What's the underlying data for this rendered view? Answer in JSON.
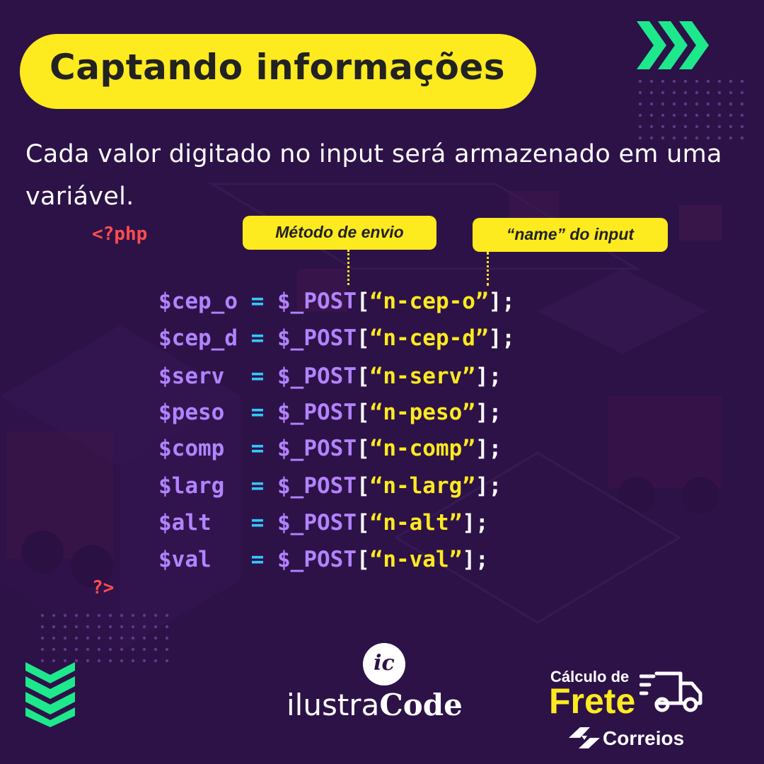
{
  "header": {
    "title": "Captando informações",
    "accent_color": "#fdea1f",
    "decor_icon": "triple-chevron-right-icon",
    "decor_color": "#1ee88c"
  },
  "description": "Cada valor digitado no input será armazenado em uma variável.",
  "callouts": {
    "method": "Método de envio",
    "name": "“name” do input"
  },
  "code": {
    "open_tag": "<?php",
    "close_tag": "?>",
    "lines": [
      {
        "var": "$cep_o",
        "pad": " ",
        "op": "=",
        "func": "$_POST",
        "key": "“n-cep-o”"
      },
      {
        "var": "$cep_d",
        "pad": " ",
        "op": "=",
        "func": "$_POST",
        "key": "“n-cep-d”"
      },
      {
        "var": "$serv",
        "pad": "  ",
        "op": "=",
        "func": "$_POST",
        "key": "“n-serv”"
      },
      {
        "var": "$peso",
        "pad": "  ",
        "op": "=",
        "func": "$_POST",
        "key": "“n-peso”"
      },
      {
        "var": "$comp",
        "pad": "  ",
        "op": "=",
        "func": "$_POST",
        "key": "“n-comp”"
      },
      {
        "var": "$larg",
        "pad": "  ",
        "op": "=",
        "func": "$_POST",
        "key": "“n-larg”"
      },
      {
        "var": "$alt",
        "pad": "   ",
        "op": "=",
        "func": "$_POST",
        "key": "“n-alt”"
      },
      {
        "var": "$val",
        "pad": "   ",
        "op": "=",
        "func": "$_POST",
        "key": "“n-val”"
      }
    ],
    "colors": {
      "tag": "#ff4d4d",
      "variable": "#b383ff",
      "operator": "#33c8ff",
      "string": "#fdea1f"
    }
  },
  "footer": {
    "logo_mark": "ic",
    "logo_word_light": "ilustra",
    "logo_word_bold": "Code",
    "frete_small": "Cálculo de",
    "frete_big": "Frete",
    "correios": "Correios",
    "truck_icon": "delivery-truck-icon",
    "left_decor_icon": "triple-chevron-down-icon"
  }
}
